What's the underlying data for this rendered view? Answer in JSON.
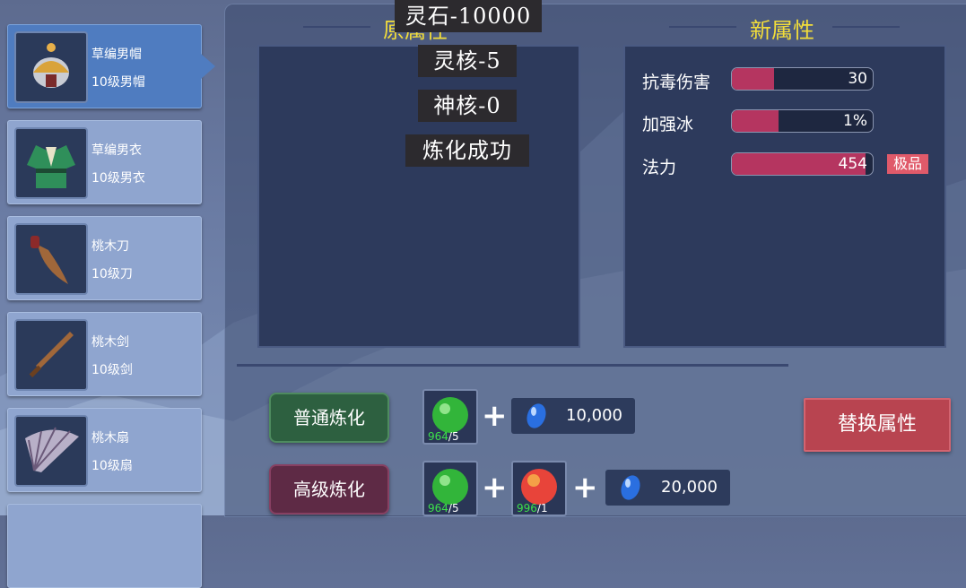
{
  "items": [
    {
      "name": "草编男帽",
      "level": "10级男帽",
      "icon": "helmet-icon",
      "selected": true
    },
    {
      "name": "草编男衣",
      "level": "10级男衣",
      "icon": "robe-icon",
      "selected": false
    },
    {
      "name": "桃木刀",
      "level": "10级刀",
      "icon": "saber-icon",
      "selected": false
    },
    {
      "name": "桃木剑",
      "level": "10级剑",
      "icon": "sword-icon",
      "selected": false
    },
    {
      "name": "桃木扇",
      "level": "10级扇",
      "icon": "fan-icon",
      "selected": false
    }
  ],
  "original_attr_title": "原属性",
  "new_attr_title": "新属性",
  "new_attrs": [
    {
      "name": "抗毒伤害",
      "value": "30",
      "fill": 0.3
    },
    {
      "name": "加强冰",
      "value": "1%",
      "fill": 0.33
    },
    {
      "name": "法力",
      "value": "454",
      "fill": 0.95
    }
  ],
  "quality_tag": "极品",
  "messages": [
    "灵石-10000",
    "灵核-5",
    "神核-0",
    "炼化成功"
  ],
  "normal_refine": {
    "label": "普通炼化",
    "materials": [
      {
        "icon": "green-orb-icon",
        "have": "964",
        "need": "/5"
      }
    ],
    "cost": "10,000"
  },
  "advanced_refine": {
    "label": "高级炼化",
    "materials": [
      {
        "icon": "green-orb-icon",
        "have": "964",
        "need": "/5"
      },
      {
        "icon": "red-orb-icon",
        "have": "996",
        "need": "/1"
      }
    ],
    "cost": "20,000"
  },
  "replace_button": "替换属性",
  "colors": {
    "title": "#f2dd3a",
    "bar_fill": "#b53560",
    "tag": "#e05a6a",
    "have_count": "#3de04a"
  }
}
